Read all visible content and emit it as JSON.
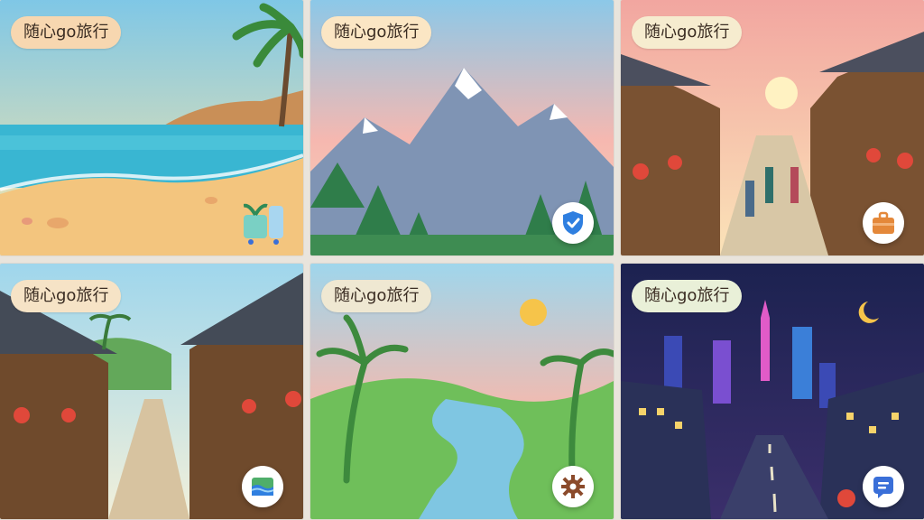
{
  "brand_label": "随心go旅行",
  "tiles": [
    {
      "scene": "beach",
      "label": "随心go旅行",
      "pill_color": "#f7d7b0",
      "badge_icon": "luggage-icon"
    },
    {
      "scene": "snow-mountains",
      "label": "随心go旅行",
      "pill_color": "#fbe6c4",
      "badge_icon": "shield-check-icon"
    },
    {
      "scene": "ancient-town-street",
      "label": "随心go旅行",
      "pill_color": "#f6eccf",
      "badge_icon": "suitcase-icon"
    },
    {
      "scene": "ancient-town-lanes",
      "label": "随心go旅行",
      "pill_color": "#f6e3c6",
      "badge_icon": "map-icon"
    },
    {
      "scene": "river-valley",
      "label": "随心go旅行",
      "pill_color": "#efe8d2",
      "badge_icon": "gear-icon"
    },
    {
      "scene": "night-city",
      "label": "随心go旅行",
      "pill_color": "#e9f0d8",
      "badge_icon": "chat-icon"
    }
  ],
  "colors": {
    "shield_blue": "#2f7fe0",
    "suitcase_orange": "#e4883a",
    "gear_brown": "#8b4a2b",
    "chat_blue": "#3a6fd8"
  }
}
